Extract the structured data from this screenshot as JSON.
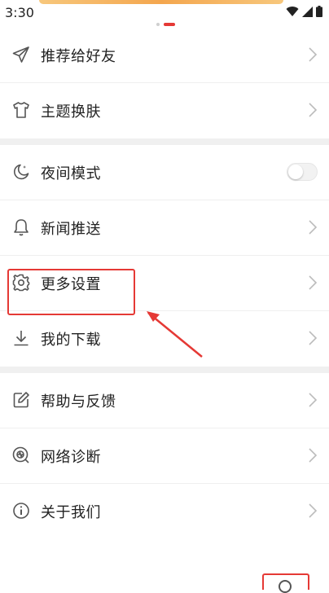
{
  "status_bar": {
    "time": "3:30",
    "icons": [
      "wifi-icon",
      "signal-icon",
      "battery-icon"
    ]
  },
  "menu": {
    "recommend": {
      "label": "推荐给好友",
      "icon": "send-icon"
    },
    "theme": {
      "label": "主题换肤",
      "icon": "tshirt-icon"
    },
    "night": {
      "label": "夜间模式",
      "icon": "moon-icon",
      "toggle_on": false
    },
    "push": {
      "label": "新闻推送",
      "icon": "bell-icon"
    },
    "settings": {
      "label": "更多设置",
      "icon": "gear-icon"
    },
    "download": {
      "label": "我的下载",
      "icon": "download-icon"
    },
    "feedback": {
      "label": "帮助与反馈",
      "icon": "edit-icon"
    },
    "diagnose": {
      "label": "网络诊断",
      "icon": "network-icon"
    },
    "about": {
      "label": "关于我们",
      "icon": "info-icon"
    }
  },
  "colors": {
    "annotation": "#e53935",
    "icon": "#555555",
    "chevron": "#bbbbbb",
    "divider": "#efefef",
    "group_gap": "#f0f0f0"
  }
}
